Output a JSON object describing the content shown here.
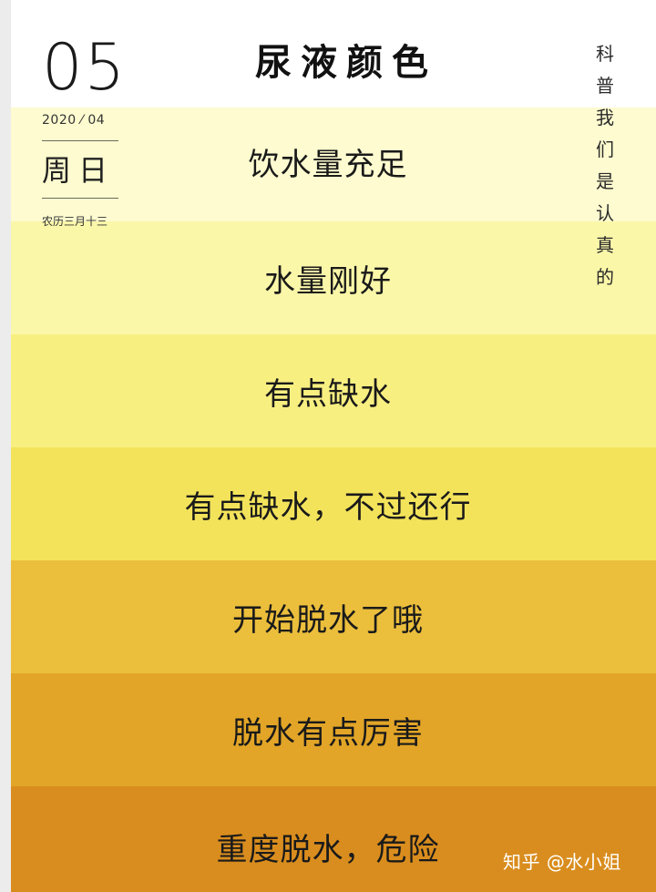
{
  "header": {
    "title": "尿液颜色",
    "day": "05",
    "year_month": "2020 ⁄ 04",
    "weekday": "周日",
    "lunar": "农历三月十三",
    "vertical": [
      "科",
      "普",
      "我",
      "们",
      "是",
      "认",
      "真",
      "的"
    ]
  },
  "bands": [
    {
      "label": "饮水量充足",
      "color": "#fdfbcf"
    },
    {
      "label": "水量刚好",
      "color": "#fbf7a9"
    },
    {
      "label": "有点缺水",
      "color": "#f8ef81"
    },
    {
      "label": "有点缺水，不过还行",
      "color": "#f3e35b"
    },
    {
      "label": "开始脱水了哦",
      "color": "#ebbe3c"
    },
    {
      "label": "脱水有点厉害",
      "color": "#e2a527"
    },
    {
      "label": "重度脱水，危险",
      "color": "#d98d1e"
    }
  ],
  "watermark": "知乎 @水小姐"
}
